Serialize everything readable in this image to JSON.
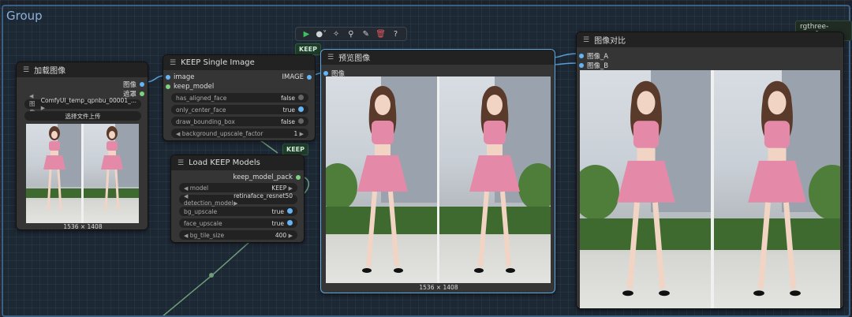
{
  "group": {
    "title": "Group"
  },
  "rgthree": {
    "label": "rgthree-comfy"
  },
  "toolbar": {
    "icons": [
      "play-icon",
      "dot-icon",
      "sparkle-icon",
      "pin-icon",
      "pencil-icon",
      "trash-icon",
      "help-icon"
    ]
  },
  "badges": {
    "keep1": "KEEP",
    "keep2": "KEEP"
  },
  "load_image": {
    "title": "加载图像",
    "out_image": "图像",
    "out_mask": "遮罩",
    "image_label": "图像",
    "image_value": "ComfyUI_temp_qpnbu_00001_...",
    "upload_label": "选择文件上传",
    "caption": "1536 × 1408"
  },
  "keep_single": {
    "title": "KEEP Single Image",
    "in_image": "image",
    "in_model": "keep_model",
    "out_image": "IMAGE",
    "widgets": [
      {
        "label": "has_aligned_face",
        "value": "false",
        "on": false
      },
      {
        "label": "only_center_face",
        "value": "true",
        "on": true
      },
      {
        "label": "draw_bounding_box",
        "value": "false",
        "on": false
      }
    ],
    "factor_label": "background_upscale_factor",
    "factor_value": "1"
  },
  "load_keep": {
    "title": "Load KEEP Models",
    "out_pack": "keep_model_pack",
    "model_label": "model",
    "model_value": "KEEP",
    "det_label": "detection_model",
    "det_value": "retinaface_resnet50",
    "bg_label": "bg_upscale",
    "bg_value": "true",
    "face_label": "face_upscale",
    "face_value": "true",
    "tile_label": "bg_tile_size",
    "tile_value": "400"
  },
  "preview": {
    "title": "预览图像",
    "in_image": "图像",
    "caption": "1536 × 1408"
  },
  "compare": {
    "title": "图像对比",
    "in_a": "图像_A",
    "in_b": "图像_B"
  },
  "colors": {
    "accent": "#64b5f6",
    "group_border": "#3d5f80",
    "node_bg": "#353535"
  }
}
